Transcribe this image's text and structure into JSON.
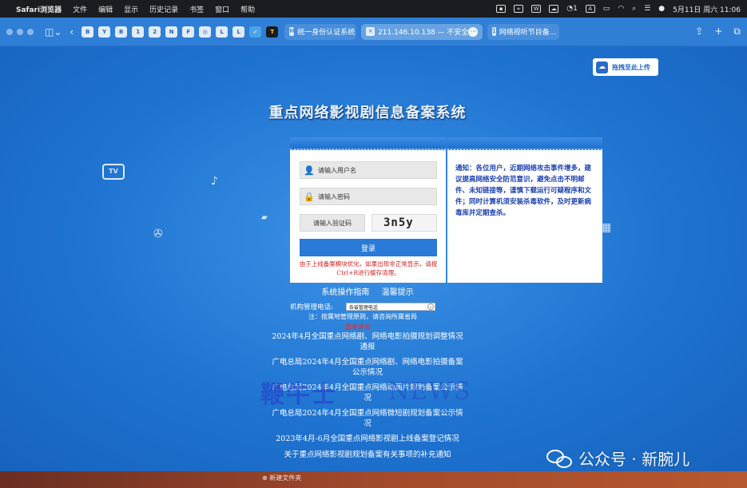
{
  "menubar": {
    "apple": "",
    "items": [
      "Safari浏览器",
      "文件",
      "编辑",
      "显示",
      "历史记录",
      "书签",
      "窗口",
      "帮助"
    ],
    "wechat_count": "1",
    "input_method": "A",
    "clock": "5月11日 周六  11:06"
  },
  "toolbar": {
    "favorites": [
      "B",
      "Y",
      "B",
      "1",
      "2",
      "N",
      "F",
      "◎",
      "L",
      "L",
      "✓",
      "T"
    ],
    "tabs": [
      {
        "icon": "M",
        "title": "统一身份认证系统"
      },
      {
        "icon": "×",
        "title": "211.146.10.138 — 不安全"
      },
      {
        "icon": "1",
        "title": "网络视听节目备..."
      }
    ],
    "tab_more": "···"
  },
  "page": {
    "upload_label": "拖拽至此上传",
    "system_title": "重点网络影视剧信息备案系统",
    "tv_label": "TV",
    "login": {
      "username_placeholder": "请输入用户名",
      "password_placeholder": "请输入密码",
      "captcha_placeholder": "请输入验证码",
      "captcha_text": "3n5y",
      "login_button": "登录",
      "warning": "由于上线备案模块优化，如果出现非正常显示，请按Ctrl+R进行缓存清理。"
    },
    "notice": "通知：各位用户，近期网络攻击事件增多，建议提高网络安全防范意识，避免点击不明邮件、未知链接等，谨慎下载运行可疑程序和文件；同时计算机须安装杀毒软件，及时更新病毒库并定期查杀。",
    "guide_link": "系统操作指南",
    "tips_link": "温馨提示",
    "phone_label": "机构管理电话:",
    "phone_select_value": "各省管理电话",
    "phone_note": "注：按属地管理原则，请咨询所属省局",
    "notice_label": "重要通知",
    "links": [
      "2024年4月全国重点网络剧、网络电影拍摄规划调整情况通报",
      "广电总局2024年4月全国重点网络剧、网络电影拍摄备案公示情况",
      "广电总局2024年4月全国重点网络动画片规划备案公示情况",
      "广电总局2024年4月全国重点网络微短剧规划备案公示情况",
      "2023年4月-6月全国重点网络影视剧上线备案登记情况",
      "关于重点网络影视剧规划备案有关事项的补充通知"
    ],
    "watermark_left": "鞭牛士",
    "watermark_right": "NEWS",
    "wechat_mark": "公众号 · 新腕儿"
  },
  "dock": {
    "folder_label": "⊕ 新建文件夹"
  }
}
